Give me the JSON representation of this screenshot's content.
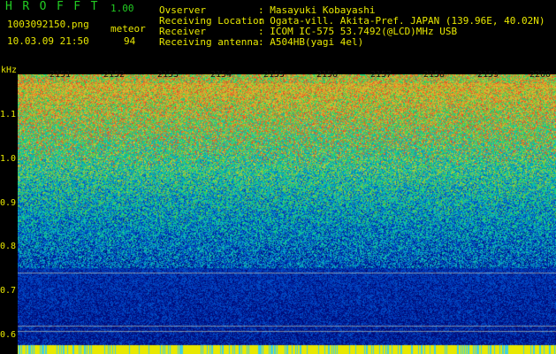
{
  "header": {
    "app_title": "HROFFT",
    "version": "1.00",
    "filename": "1003092150.png",
    "datetime": "10.03.09 21:50",
    "meteor_label": "meteor",
    "meteor_count": "94",
    "fields": [
      {
        "label": "Ovserver",
        "value": ": Masayuki Kobayashi"
      },
      {
        "label": "Receiving Location",
        "value": ": Ogata-vill. Akita-Pref. JAPAN (139.96E, 40.02N)"
      },
      {
        "label": "Receiver",
        "value": ": ICOM IC-575 53.7492(@LCD)MHz USB"
      },
      {
        "label": "Receiving antenna",
        "value": ": A504HB(yagi 4el)"
      }
    ]
  },
  "spectrogram": {
    "y_unit": "kHz",
    "y_ticks": [
      "1.1",
      "1.0",
      "0.9",
      "0.8",
      "0.7",
      "0.6"
    ],
    "x_ticks": [
      "2151",
      "2152",
      "2153",
      "2154",
      "2155",
      "2156",
      "2157",
      "2158",
      "2159",
      "2200"
    ],
    "colors": {
      "low": "#0a14a0",
      "mid": "#1e96c8",
      "high": "#46c846",
      "hot": "#e63232",
      "axis_text": "#e8e800",
      "baseline": "#e8e800"
    }
  }
}
